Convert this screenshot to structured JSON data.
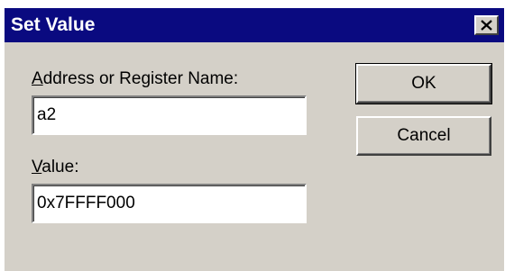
{
  "window": {
    "title": "Set Value",
    "close_icon": "close-icon"
  },
  "address": {
    "label_mnemonic": "A",
    "label_rest": "ddress or Register Name:",
    "value": "a2"
  },
  "value": {
    "label_mnemonic": "V",
    "label_rest": "alue:",
    "value": "0x7FFFF000"
  },
  "buttons": {
    "ok_label": "OK",
    "cancel_label": "Cancel"
  },
  "colors": {
    "titlebar": "#0a0a80",
    "dialog_face": "#d4d0c8",
    "field_background": "#ffffff"
  }
}
